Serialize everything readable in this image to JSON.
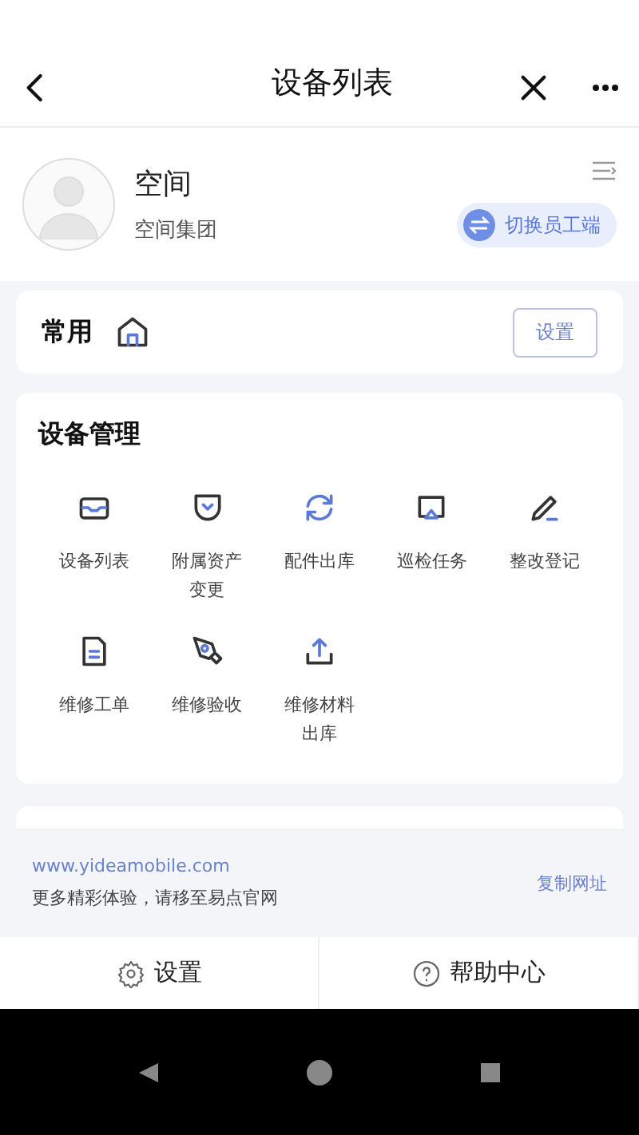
{
  "nav_bar": {
    "title": "设备列表"
  },
  "profile": {
    "name": "空间",
    "company": "空间集团",
    "switch_button": "切换员工端"
  },
  "common": {
    "title": "常用",
    "settings_button": "设置"
  },
  "device_management": {
    "title": "设备管理",
    "items": [
      {
        "label": "设备列表",
        "kind": "inbox"
      },
      {
        "label": "附属资产变更",
        "kind": "pocket"
      },
      {
        "label": "配件出库",
        "kind": "refresh"
      },
      {
        "label": "巡检任务",
        "kind": "cast"
      },
      {
        "label": "整改登记",
        "kind": "pen"
      },
      {
        "label": "维修工单",
        "kind": "doc"
      },
      {
        "label": "维修验收",
        "kind": "nib"
      },
      {
        "label": "维修材料出库",
        "kind": "upload"
      }
    ]
  },
  "footer": {
    "url": "www.yideamobile.com",
    "note": "更多精彩体验，请移至易点官网",
    "copy_link": "复制网址"
  },
  "bottom_tabs": [
    {
      "label": "设置",
      "kind": "gear"
    },
    {
      "label": "帮助中心",
      "kind": "help"
    }
  ]
}
